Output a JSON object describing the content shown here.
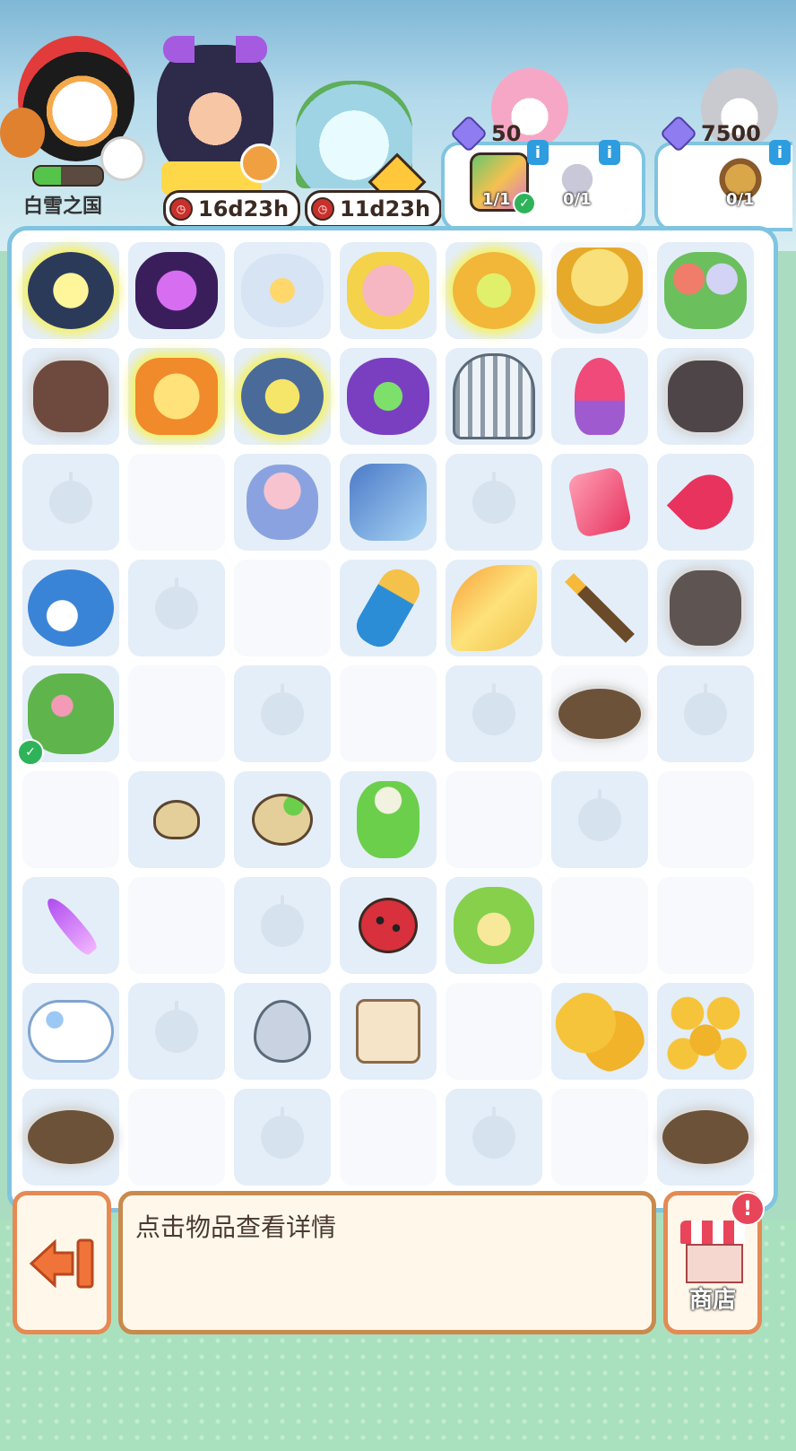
{
  "header": {
    "kingdom_label": "白雪之国",
    "timer1": "16d23h",
    "timer2": "11d23h",
    "quest1": {
      "count": "50",
      "item1_progress": "1/1",
      "item2_progress": "0/1"
    },
    "quest2": {
      "count": "7500",
      "item1_progress": "0/1"
    }
  },
  "info_text": "点击物品查看详情",
  "shop_label": "商店",
  "shop_alert": "!",
  "colors": {
    "board_border": "#7fc4e0",
    "exit_border": "#e58a54",
    "info_border": "#c98a4e",
    "accent_red": "#e8455a"
  },
  "board": {
    "rows": [
      [
        "sparkle-cloud-item",
        "purple-ritual-item",
        "ice-flower-item",
        "deer-plush-item",
        "gold-swirl-item",
        "gold-crown-item",
        "flower-bouquet-item"
      ],
      [
        "webbed-rooster-item",
        "orange-treasure-item",
        "blue-mirror-item",
        "green-swirl-item",
        "silver-cage-item",
        "pink-tulip-item",
        "webbed-eagle-item"
      ],
      [
        "empty",
        "empty",
        "bunny-fairy-item",
        "blue-glass-shoe-item",
        "empty",
        "pink-crystal-item",
        "pink-gem-drop-item"
      ],
      [
        "blue-dolphin-item",
        "empty",
        "empty",
        "arrow-quiver-item",
        "golden-wing-item",
        "gold-arrow-item",
        "webbed-bow-item"
      ],
      [
        "green-crocodile-item",
        "empty",
        "empty",
        "empty",
        "empty",
        "webbed-bird-nest-item",
        "empty"
      ],
      [
        "empty",
        "seed-item",
        "sprout-item",
        "flower-bud-item",
        "empty",
        "empty",
        "empty"
      ],
      [
        "purple-crystal-item",
        "empty",
        "empty",
        "ladybug-item",
        "frog-item",
        "empty",
        "empty"
      ],
      [
        "cloud-item",
        "empty",
        "heart-lock-item",
        "sugar-cube-item",
        "empty",
        "two-coins-item",
        "coin-pile-item"
      ],
      [
        "webbed-bird-nest-item",
        "empty",
        "empty",
        "empty",
        "empty",
        "empty",
        "webbed-bird-nest-item"
      ]
    ]
  }
}
